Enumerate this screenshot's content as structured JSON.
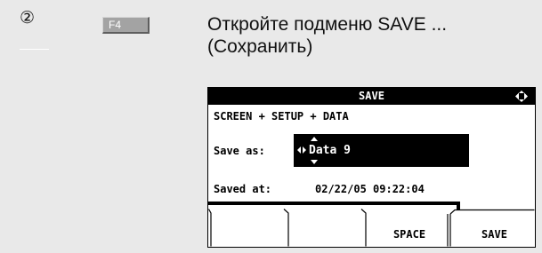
{
  "step": {
    "number": "②"
  },
  "key": {
    "label": "F4"
  },
  "instruction": {
    "line1": "Откройте подменю SAVE ...",
    "line2": "(Сохранить)"
  },
  "screen": {
    "title": "SAVE",
    "content_label": "SCREEN + SETUP + DATA",
    "save_as_label": "Save as:",
    "save_as_value": "Data 9",
    "saved_at_label": "Saved at:",
    "saved_at_value": "02/22/05 09:22:04",
    "softkeys": [
      "",
      "",
      "SPACE",
      "SAVE"
    ]
  },
  "icons": {
    "nav": "four-way-arrows-icon",
    "left_right": "left-right-arrows-icon",
    "up_down": "up-down-arrows-icon"
  }
}
